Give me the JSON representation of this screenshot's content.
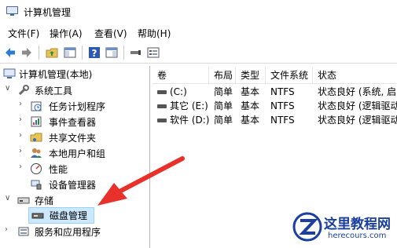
{
  "window": {
    "title": "计算机管理"
  },
  "menu": {
    "items": [
      "文件(F)",
      "操作(A)",
      "查看(V)",
      "帮助(H)"
    ]
  },
  "tree": {
    "root": "计算机管理(本地)",
    "system_tools": "系统工具",
    "task_scheduler": "任务计划程序",
    "event_viewer": "事件查看器",
    "shared_folders": "共享文件夹",
    "local_users": "本地用户和组",
    "performance": "性能",
    "device_manager": "设备管理器",
    "storage": "存储",
    "disk_management": "磁盘管理",
    "services_apps": "服务和应用程序"
  },
  "table": {
    "columns": [
      "卷",
      "布局",
      "类型",
      "文件系统",
      "状态"
    ],
    "rows": [
      {
        "volume": "(C:)",
        "layout": "简单",
        "type": "基本",
        "fs": "NTFS",
        "status": "状态良好 (系统, 启"
      },
      {
        "volume": "其它 (E:)",
        "layout": "简单",
        "type": "基本",
        "fs": "NTFS",
        "status": "状态良好 (逻辑驱动"
      },
      {
        "volume": "软件 (D:)",
        "layout": "简单",
        "type": "基本",
        "fs": "NTFS",
        "status": "状态良好 (逻辑驱动"
      }
    ]
  },
  "watermark": {
    "title": "这里教程网",
    "url": "herecours.com"
  },
  "colors": {
    "selection": "#cce8ff",
    "arrow": "#e8312a",
    "watermark": "#1a3fa0"
  }
}
